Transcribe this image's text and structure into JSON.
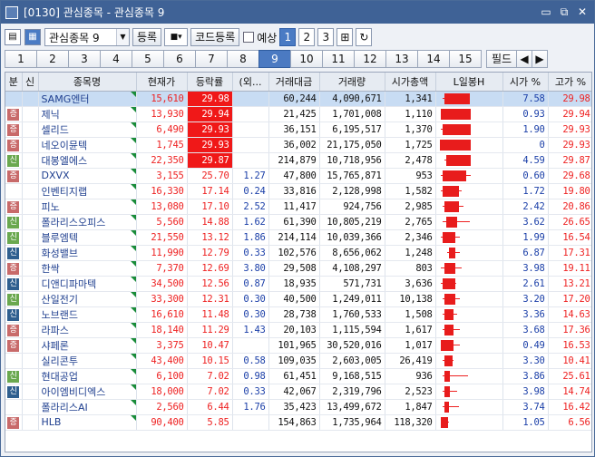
{
  "window": {
    "title": "[0130] 관심종목 - 관심종목 9",
    "controls": [
      "▭",
      "⧉",
      "✕"
    ]
  },
  "toolbar": {
    "group_select": "관심종목 9",
    "register_label": "등록",
    "code_register_label": "코드등록",
    "forecast_label": "예상",
    "pages": [
      "1",
      "2",
      "3"
    ]
  },
  "tabs": {
    "items": [
      "1",
      "2",
      "3",
      "4",
      "5",
      "6",
      "7",
      "8",
      "9",
      "10",
      "11",
      "12",
      "13",
      "14",
      "15"
    ],
    "active": "9",
    "field_label": "필드"
  },
  "table": {
    "headers": [
      "분",
      "신",
      "종목명",
      "현재가",
      "등락률",
      "(외...",
      "거래대금",
      "거래량",
      "시가총액",
      "L일봉H",
      "시가 %",
      "고가 %"
    ],
    "rows": [
      {
        "tag": "",
        "tagc": "",
        "name": "SAMG엔터",
        "price": "15,610",
        "rate": "29.98",
        "rhi": true,
        "ext": "",
        "amt": "60,244",
        "vol": "4,090,671",
        "cap": "1,341",
        "op": "7.58",
        "hp": "29.98",
        "c": [
          0.15,
          0.95,
          0.1,
          0.95
        ]
      },
      {
        "tag": "증",
        "tagc": "#c86a6a",
        "name": "제닉",
        "price": "13,930",
        "rate": "29.94",
        "rhi": true,
        "ext": "",
        "amt": "21,425",
        "vol": "1,701,008",
        "cap": "1,110",
        "op": "0.93",
        "hp": "29.94",
        "c": [
          0.05,
          0.98,
          0.05,
          0.98
        ]
      },
      {
        "tag": "증",
        "tagc": "#c86a6a",
        "name": "셀리드",
        "price": "6,490",
        "rate": "29.93",
        "rhi": true,
        "ext": "",
        "amt": "36,151",
        "vol": "6,195,517",
        "cap": "1,370",
        "op": "1.90",
        "hp": "29.93",
        "c": [
          0.1,
          0.98,
          0.05,
          0.98
        ]
      },
      {
        "tag": "증",
        "tagc": "#c86a6a",
        "name": "네오이뮨텍",
        "price": "1,745",
        "rate": "29.93",
        "rhi": true,
        "ext": "",
        "amt": "36,002",
        "vol": "21,175,050",
        "cap": "1,725",
        "op": "0",
        "hp": "29.93",
        "c": [
          0.0,
          0.98,
          0.0,
          0.98
        ]
      },
      {
        "tag": "신",
        "tagc": "#6aa84f",
        "name": "대봉엘에스",
        "price": "22,350",
        "rate": "29.87",
        "rhi": true,
        "ext": "",
        "amt": "214,879",
        "vol": "10,718,956",
        "cap": "2,478",
        "op": "4.59",
        "hp": "29.87",
        "c": [
          0.2,
          0.98,
          0.15,
          0.98
        ]
      },
      {
        "tag": "증",
        "tagc": "#c86a6a",
        "name": "DXVX",
        "price": "3,155",
        "rate": "25.70",
        "rhi": false,
        "ext": "1.27",
        "amt": "47,800",
        "vol": "15,765,871",
        "cap": "953",
        "op": "0.60",
        "hp": "29.68",
        "c": [
          0.1,
          0.85,
          0.05,
          0.98
        ]
      },
      {
        "tag": "",
        "tagc": "",
        "name": "인벤티지랩",
        "price": "16,330",
        "rate": "17.14",
        "rhi": false,
        "ext": "0.24",
        "amt": "33,816",
        "vol": "2,128,998",
        "cap": "1,582",
        "op": "1.72",
        "hp": "19.80",
        "c": [
          0.1,
          0.6,
          0.05,
          0.7
        ]
      },
      {
        "tag": "증",
        "tagc": "#c86a6a",
        "name": "피노",
        "price": "13,080",
        "rate": "17.10",
        "rhi": false,
        "ext": "2.52",
        "amt": "11,417",
        "vol": "924,756",
        "cap": "2,985",
        "op": "2.42",
        "hp": "20.86",
        "c": [
          0.15,
          0.62,
          0.1,
          0.75
        ]
      },
      {
        "tag": "신",
        "tagc": "#6aa84f",
        "name": "폴라리스오피스",
        "price": "5,560",
        "rate": "14.88",
        "rhi": false,
        "ext": "1.62",
        "amt": "61,390",
        "vol": "10,805,219",
        "cap": "2,765",
        "op": "3.62",
        "hp": "26.65",
        "c": [
          0.2,
          0.55,
          0.1,
          0.95
        ]
      },
      {
        "tag": "신",
        "tagc": "#6aa84f",
        "name": "블루엠텍",
        "price": "21,550",
        "rate": "13.12",
        "rhi": false,
        "ext": "1.86",
        "amt": "214,114",
        "vol": "10,039,366",
        "cap": "2,346",
        "op": "1.99",
        "hp": "16.54",
        "c": [
          0.1,
          0.5,
          0.05,
          0.65
        ]
      },
      {
        "tag": "신",
        "tagc": "#2f5f8f",
        "name": "화성밸브",
        "price": "11,990",
        "rate": "12.79",
        "rhi": false,
        "ext": "0.33",
        "amt": "102,576",
        "vol": "8,656,062",
        "cap": "1,248",
        "op": "6.87",
        "hp": "17.31",
        "c": [
          0.3,
          0.5,
          0.25,
          0.65
        ]
      },
      {
        "tag": "증",
        "tagc": "#c86a6a",
        "name": "한싹",
        "price": "7,370",
        "rate": "12.69",
        "rhi": false,
        "ext": "3.80",
        "amt": "29,508",
        "vol": "4,108,297",
        "cap": "803",
        "op": "3.98",
        "hp": "19.11",
        "c": [
          0.15,
          0.5,
          0.05,
          0.7
        ]
      },
      {
        "tag": "신",
        "tagc": "#2f5f8f",
        "name": "디앤디파마텍",
        "price": "34,500",
        "rate": "12.56",
        "rhi": false,
        "ext": "0.87",
        "amt": "18,935",
        "vol": "571,731",
        "cap": "3,636",
        "op": "2.61",
        "hp": "13.21",
        "c": [
          0.1,
          0.5,
          0.05,
          0.52
        ]
      },
      {
        "tag": "신",
        "tagc": "#6aa84f",
        "name": "산일전기",
        "price": "33,300",
        "rate": "12.31",
        "rhi": false,
        "ext": "0.30",
        "amt": "40,500",
        "vol": "1,249,011",
        "cap": "10,138",
        "op": "3.20",
        "hp": "17.20",
        "c": [
          0.15,
          0.5,
          0.1,
          0.65
        ]
      },
      {
        "tag": "신",
        "tagc": "#2f5f8f",
        "name": "노브랜드",
        "price": "16,610",
        "rate": "11.48",
        "rhi": false,
        "ext": "0.30",
        "amt": "28,738",
        "vol": "1,760,533",
        "cap": "1,508",
        "op": "3.36",
        "hp": "14.63",
        "c": [
          0.15,
          0.45,
          0.1,
          0.55
        ]
      },
      {
        "tag": "증",
        "tagc": "#c86a6a",
        "name": "라파스",
        "price": "18,140",
        "rate": "11.29",
        "rhi": false,
        "ext": "1.43",
        "amt": "20,103",
        "vol": "1,115,594",
        "cap": "1,617",
        "op": "3.68",
        "hp": "17.36",
        "c": [
          0.15,
          0.45,
          0.1,
          0.65
        ]
      },
      {
        "tag": "증",
        "tagc": "#c86a6a",
        "name": "샤페론",
        "price": "3,375",
        "rate": "10.47",
        "rhi": false,
        "ext": "",
        "amt": "101,965",
        "vol": "30,520,016",
        "cap": "1,017",
        "op": "0.49",
        "hp": "16.53",
        "c": [
          0.05,
          0.45,
          0.05,
          0.65
        ]
      },
      {
        "tag": "",
        "tagc": "",
        "name": "실리콘투",
        "price": "43,400",
        "rate": "10.15",
        "rhi": false,
        "ext": "0.58",
        "amt": "109,035",
        "vol": "2,603,005",
        "cap": "26,419",
        "op": "3.30",
        "hp": "10.41",
        "c": [
          0.15,
          0.42,
          0.1,
          0.45
        ]
      },
      {
        "tag": "신",
        "tagc": "#6aa84f",
        "name": "현대공업",
        "price": "6,100",
        "rate": "7.02",
        "rhi": false,
        "ext": "0.98",
        "amt": "61,451",
        "vol": "9,168,515",
        "cap": "936",
        "op": "3.86",
        "hp": "25.61",
        "c": [
          0.15,
          0.32,
          0.1,
          0.9
        ]
      },
      {
        "tag": "신",
        "tagc": "#2f5f8f",
        "name": "아이엠비디엑스",
        "price": "18,000",
        "rate": "7.02",
        "rhi": false,
        "ext": "0.33",
        "amt": "42,067",
        "vol": "2,319,796",
        "cap": "2,523",
        "op": "3.98",
        "hp": "14.74",
        "c": [
          0.15,
          0.32,
          0.1,
          0.55
        ]
      },
      {
        "tag": "",
        "tagc": "",
        "name": "폴라리스AI",
        "price": "2,560",
        "rate": "6.44",
        "rhi": false,
        "ext": "1.76",
        "amt": "35,423",
        "vol": "13,499,672",
        "cap": "1,847",
        "op": "3.74",
        "hp": "16.42",
        "c": [
          0.15,
          0.3,
          0.1,
          0.62
        ]
      },
      {
        "tag": "증",
        "tagc": "#c86a6a",
        "name": "HLB",
        "price": "90,400",
        "rate": "5.85",
        "rhi": false,
        "ext": "",
        "amt": "154,863",
        "vol": "1,735,964",
        "cap": "118,320",
        "op": "1.05",
        "hp": "6.56",
        "c": [
          0.05,
          0.28,
          0.05,
          0.3
        ]
      }
    ]
  }
}
